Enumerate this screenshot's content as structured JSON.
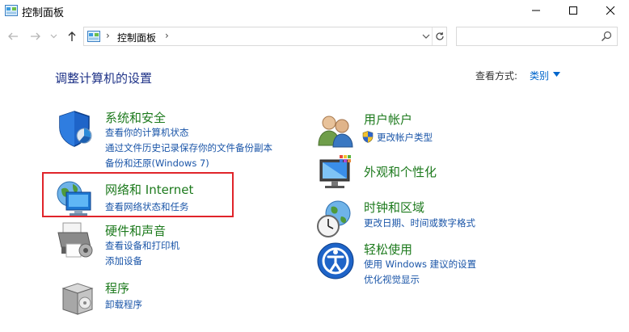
{
  "window": {
    "title": "控制面板"
  },
  "address_bar": {
    "crumb": "控制面板",
    "separator": "›"
  },
  "search": {
    "placeholder": ""
  },
  "header": {
    "title": "调整计算机的设置",
    "view_by_label": "查看方式:",
    "view_by_value": "类别"
  },
  "categories": [
    {
      "name": "系统和安全",
      "links": [
        "查看你的计算机状态",
        "通过文件历史记录保存你的文件备份副本",
        "备份和还原(Windows 7)"
      ]
    },
    {
      "name": "网络和 Internet",
      "links": [
        "查看网络状态和任务"
      ]
    },
    {
      "name": "硬件和声音",
      "links": [
        "查看设备和打印机",
        "添加设备"
      ]
    },
    {
      "name": "程序",
      "links": [
        "卸载程序"
      ]
    },
    {
      "name": "用户帐户",
      "links": [
        "更改帐户类型"
      ]
    },
    {
      "name": "外观和个性化",
      "links": []
    },
    {
      "name": "时钟和区域",
      "links": [
        "更改日期、时间或数字格式"
      ]
    },
    {
      "name": "轻松使用",
      "links": [
        "使用 Windows 建议的设置",
        "优化视觉显示"
      ]
    }
  ],
  "colors": {
    "category_title": "#1d7a1d",
    "link": "#1a55a8",
    "page_title": "#1e3287",
    "highlight_border": "#e0242a"
  }
}
